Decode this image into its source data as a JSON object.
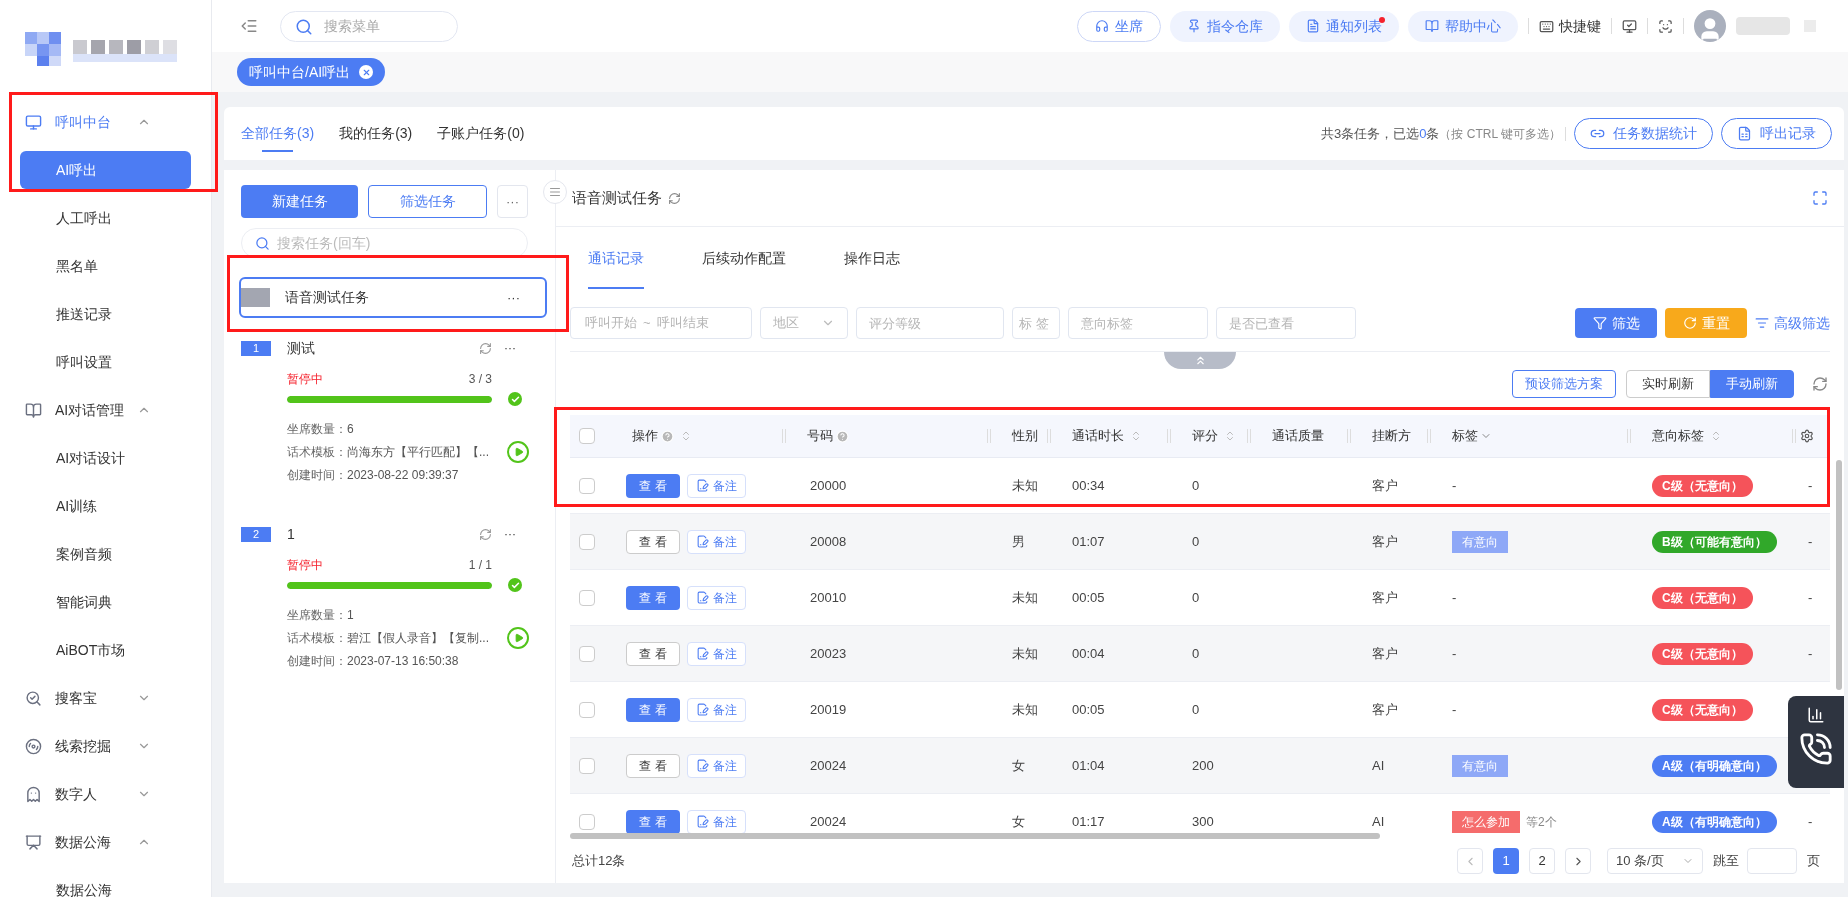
{
  "sidebar": {
    "groups": [
      {
        "label": "呼叫中台",
        "selected": true,
        "expanded": true,
        "children": [
          {
            "label": "AI呼出",
            "selected": true
          },
          {
            "label": "人工呼出",
            "selected": false
          },
          {
            "label": "黑名单",
            "selected": false
          },
          {
            "label": "推送记录",
            "selected": false
          },
          {
            "label": "呼叫设置",
            "selected": false
          }
        ]
      },
      {
        "label": "AI对话管理",
        "selected": false,
        "expanded": true,
        "children": [
          {
            "label": "AI对话设计",
            "selected": false
          },
          {
            "label": "AI训练",
            "selected": false
          },
          {
            "label": "案例音频",
            "selected": false
          },
          {
            "label": "智能词典",
            "selected": false
          },
          {
            "label": "AiBOT市场",
            "selected": false
          }
        ]
      },
      {
        "label": "搜客宝",
        "selected": false,
        "expanded": false
      },
      {
        "label": "线索挖掘",
        "selected": false,
        "expanded": false
      },
      {
        "label": "数字人",
        "selected": false,
        "expanded": false
      },
      {
        "label": "数据公海",
        "selected": false,
        "expanded": true,
        "children": [
          {
            "label": "数据公海",
            "selected": false
          }
        ]
      }
    ]
  },
  "topbar": {
    "search_placeholder": "搜索菜单",
    "buttons": [
      {
        "label": "坐席",
        "kind": "outline",
        "dot": false
      },
      {
        "label": "指令仓库",
        "kind": "soft",
        "dot": false
      },
      {
        "label": "通知列表",
        "kind": "soft",
        "dot": true
      },
      {
        "label": "帮助中心",
        "kind": "soft",
        "dot": false
      }
    ],
    "shortcut": "快捷键"
  },
  "breadcrumb_tag": "呼叫中台/AI呼出",
  "tabs": [
    {
      "label": "全部任务(3)",
      "selected": true
    },
    {
      "label": "我的任务(3)",
      "selected": false
    },
    {
      "label": "子账户任务(0)",
      "selected": false
    }
  ],
  "summary": {
    "prefix": "共3条任务，已选",
    "count": "0",
    "suffix": "条",
    "hint": "（按 CTRL 键可多选）",
    "buttons": [
      "任务数据统计",
      "呼出记录"
    ]
  },
  "task_panel": {
    "new_button": "新建任务",
    "filter_button": "筛选任务",
    "more": "···",
    "search_placeholder": "搜索任务(回车)",
    "folder": {
      "name": "语音测试任务",
      "more": "···",
      "selected": true
    },
    "tasks": [
      {
        "index": "1",
        "name": "测试",
        "more": "···",
        "status": "暂停中",
        "progress": "3 / 3",
        "level": 1,
        "fields": [
          {
            "label": "坐席数量：",
            "value": "6"
          },
          {
            "label": "话术模板：",
            "value": "尚海东方【平行匹配】【..."
          },
          {
            "label": "创建时间：",
            "value": "2023-08-22 09:39:37"
          }
        ]
      },
      {
        "index": "2",
        "name": "1",
        "more": "···",
        "status": "暂停中",
        "progress": "1 / 1",
        "level": 1,
        "fields": [
          {
            "label": "坐席数量：",
            "value": "1"
          },
          {
            "label": "话术模板：",
            "value": "碧江【假人录音】【复制..."
          },
          {
            "label": "创建时间：",
            "value": "2023-07-13 16:50:38"
          }
        ]
      }
    ]
  },
  "detail": {
    "title": "语音测试任务",
    "tabs": [
      {
        "label": "通话记录",
        "selected": true
      },
      {
        "label": "后续动作配置",
        "selected": false
      },
      {
        "label": "操作日志",
        "selected": false
      }
    ],
    "filters": [
      {
        "kind": "range",
        "start": "呼叫开始",
        "separator": "~",
        "end": "呼叫结束"
      },
      {
        "kind": "select",
        "placeholder": "地区"
      },
      {
        "kind": "input",
        "placeholder": "评分等级"
      },
      {
        "kind": "narrow",
        "placeholder": "标 签"
      },
      {
        "kind": "input",
        "placeholder": "意向标签"
      },
      {
        "kind": "input",
        "placeholder": "是否已查看"
      }
    ],
    "filter_button": "筛选",
    "reset_button": "重置",
    "advanced_button": "高级筛选",
    "preset_button": "预设筛选方案",
    "refresh_modes": [
      {
        "label": "实时刷新",
        "selected": false
      },
      {
        "label": "手动刷新",
        "selected": true
      }
    ],
    "table": {
      "columns": [
        {
          "label": "操作",
          "help": true,
          "sortable": true,
          "filter": false
        },
        {
          "label": "号码",
          "help": true,
          "sortable": false,
          "filter": false
        },
        {
          "label": "性别",
          "help": false,
          "sortable": false,
          "filter": false
        },
        {
          "label": "通话时长",
          "help": false,
          "sortable": true,
          "filter": false
        },
        {
          "label": "评分",
          "help": false,
          "sortable": true,
          "filter": false
        },
        {
          "label": "通话质量",
          "help": false,
          "sortable": false,
          "filter": false
        },
        {
          "label": "挂断方",
          "help": false,
          "sortable": false,
          "filter": false
        },
        {
          "label": "标签",
          "help": false,
          "sortable": false,
          "filter": true
        },
        {
          "label": "意向标签",
          "help": false,
          "sortable": true,
          "filter": false
        }
      ],
      "header_checked": false,
      "rows": [
        {
          "checked": false,
          "view": "查 看",
          "note": "备注",
          "viewed": false,
          "number": "20000",
          "gender": "未知",
          "duration": "00:34",
          "score": "0",
          "hangup": "客户",
          "tags": [],
          "tags_empty": "-",
          "intent": {
            "text": "C级（无意向）",
            "color": "#f5535a"
          },
          "last": "-"
        },
        {
          "checked": false,
          "view": "查 看",
          "note": "备注",
          "viewed": true,
          "number": "20008",
          "gender": "男",
          "duration": "01:07",
          "score": "0",
          "hangup": "客户",
          "tags": [
            {
              "text": "有意向",
              "color": "#8ea8f7"
            }
          ],
          "intent": {
            "text": "B级（可能有意向）",
            "color": "#31a82a"
          },
          "last": "-"
        },
        {
          "checked": false,
          "view": "查 看",
          "note": "备注",
          "viewed": false,
          "number": "20010",
          "gender": "未知",
          "duration": "00:05",
          "score": "0",
          "hangup": "客户",
          "tags": [],
          "tags_empty": "-",
          "intent": {
            "text": "C级（无意向）",
            "color": "#f5535a"
          },
          "last": "-"
        },
        {
          "checked": false,
          "view": "查 看",
          "note": "备注",
          "viewed": true,
          "number": "20023",
          "gender": "未知",
          "duration": "00:04",
          "score": "0",
          "hangup": "客户",
          "tags": [],
          "tags_empty": "-",
          "intent": {
            "text": "C级（无意向）",
            "color": "#f5535a"
          },
          "last": "-"
        },
        {
          "checked": false,
          "view": "查 看",
          "note": "备注",
          "viewed": false,
          "number": "20019",
          "gender": "未知",
          "duration": "00:05",
          "score": "0",
          "hangup": "客户",
          "tags": [],
          "tags_empty": "-",
          "intent": {
            "text": "C级（无意向）",
            "color": "#f5535a"
          }
        },
        {
          "checked": false,
          "view": "查 看",
          "note": "备注",
          "viewed": true,
          "number": "20024",
          "gender": "女",
          "duration": "01:04",
          "score": "200",
          "hangup": "AI",
          "tags": [
            {
              "text": "有意向",
              "color": "#8ea8f7"
            }
          ],
          "intent": {
            "text": "A级（有明确意向）",
            "color": "#4c7cf3"
          }
        },
        {
          "checked": false,
          "view": "查 看",
          "note": "备注",
          "viewed": false,
          "number": "20024",
          "gender": "女",
          "duration": "01:17",
          "score": "300",
          "hangup": "AI",
          "tags": [
            {
              "text": "怎么参加",
              "color": "#f56c6c"
            }
          ],
          "tags_more": "等2个",
          "intent": {
            "text": "A级（有明确意向）",
            "color": "#4c7cf3"
          },
          "last": "-"
        }
      ]
    },
    "total": "总计12条",
    "pagination": {
      "pages": [
        {
          "label": "1",
          "selected": true
        },
        {
          "label": "2",
          "selected": false
        }
      ],
      "page_size": "10 条/页",
      "jump_label": "跳至",
      "page_unit": "页"
    }
  }
}
